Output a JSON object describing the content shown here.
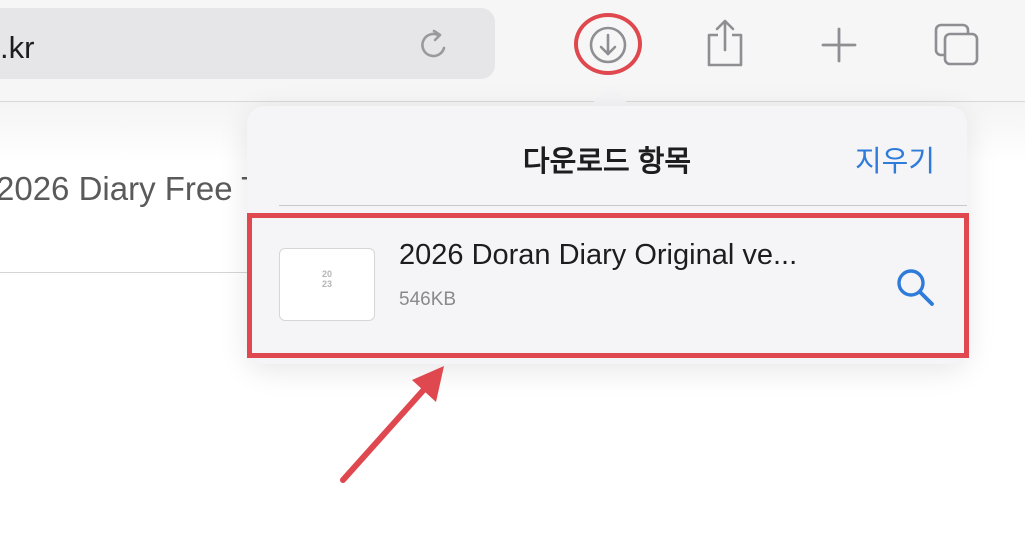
{
  "browser": {
    "url_text": ".kr"
  },
  "page": {
    "background_title": "2026 Diary Free T"
  },
  "downloads_popover": {
    "title": "다운로드 항목",
    "clear_label": "지우기",
    "items": [
      {
        "file_name": "2026  Doran Diary Original ve...",
        "file_size": "546KB",
        "thumbnail_text": "20\n23"
      }
    ]
  },
  "colors": {
    "accent_blue": "#2f7bd9",
    "highlight_red": "#e04850"
  },
  "icons": [
    "reload-icon",
    "download-icon",
    "share-icon",
    "new-tab-icon",
    "tabs-icon",
    "magnifier-icon"
  ]
}
